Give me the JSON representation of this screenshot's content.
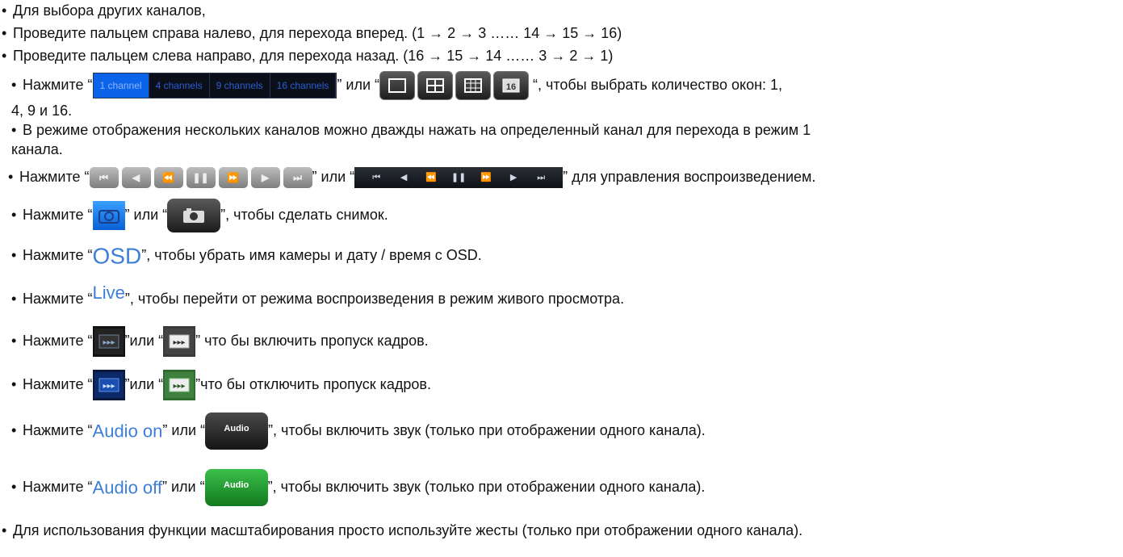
{
  "bullet": "•",
  "lines": {
    "l1": "Для выбора других каналов,",
    "l2": "Проведите пальцем справа налево, для перехода вперед. (1 → 2 → 3 …… 14 → 15 → 16)",
    "l3": "Проведите пальцем слева направо, для перехода назад. (16 → 15 → 14 …… 3 → 2 → 1)",
    "l4a": "Нажмите “",
    "l4b": "” или “",
    "l4c": " “, чтобы выбрать количество окон: 1,",
    "l4d": "4, 9 и 16.",
    "l5a": "В режиме отображения нескольких каналов можно дважды нажать на определенный канал для перехода в режим 1",
    "l5b": "канала.",
    "l6a": "Нажмите “",
    "l6b": "” или “",
    "l6c": "” для управления воспроизведением.",
    "l7a": "Нажмите “",
    "l7b": "” или “",
    "l7c": "”, чтобы сделать снимок.",
    "l8a": "Нажмите “",
    "l8c": "”, чтобы убрать имя камеры и дату / время с OSD.",
    "l9a": "Нажмите “",
    "l9c": "”, чтобы перейти от режима воспроизведения в режим живого просмотра.",
    "l10a": "Нажмите  “",
    "l10b": "”или “",
    "l10c": "” что бы включить пропуск кадров.",
    "l11a": "Нажмите  “",
    "l11b": "”или “",
    "l11c": "”что бы отключить пропуск кадров.",
    "l12a": "Нажмите “",
    "l12b": "” или “",
    "l12c": "”, чтобы включить звук (только при отображении одного канала).",
    "l13a": "Нажмите “",
    "l13b": "” или “",
    "l13c": "”, чтобы включить звук (только при отображении одного канала).",
    "l14": "Для использования функции масштабирования просто используйте жесты (только при отображении одного канала)."
  },
  "channel_tabs": [
    "1 channel",
    "4 channels",
    "9 channels",
    "16 channels"
  ],
  "grid_icon_16": "16",
  "playback_icons": [
    "skip-to-start-icon",
    "step-back-icon",
    "rewind-icon",
    "pause-icon",
    "fast-forward-icon",
    "step-forward-icon",
    "skip-to-end-icon"
  ],
  "osd_label": "OSD",
  "live_label": "Live",
  "audio_on_label": "Audio on",
  "audio_off_label": "Audio off",
  "audio_btn_label": "Audio",
  "colors": {
    "accent": "#3d7fd6",
    "tab_active": "#0a63e8",
    "audio_on_btn": "#2a2a2a",
    "audio_off_btn": "#1f9e2e"
  }
}
